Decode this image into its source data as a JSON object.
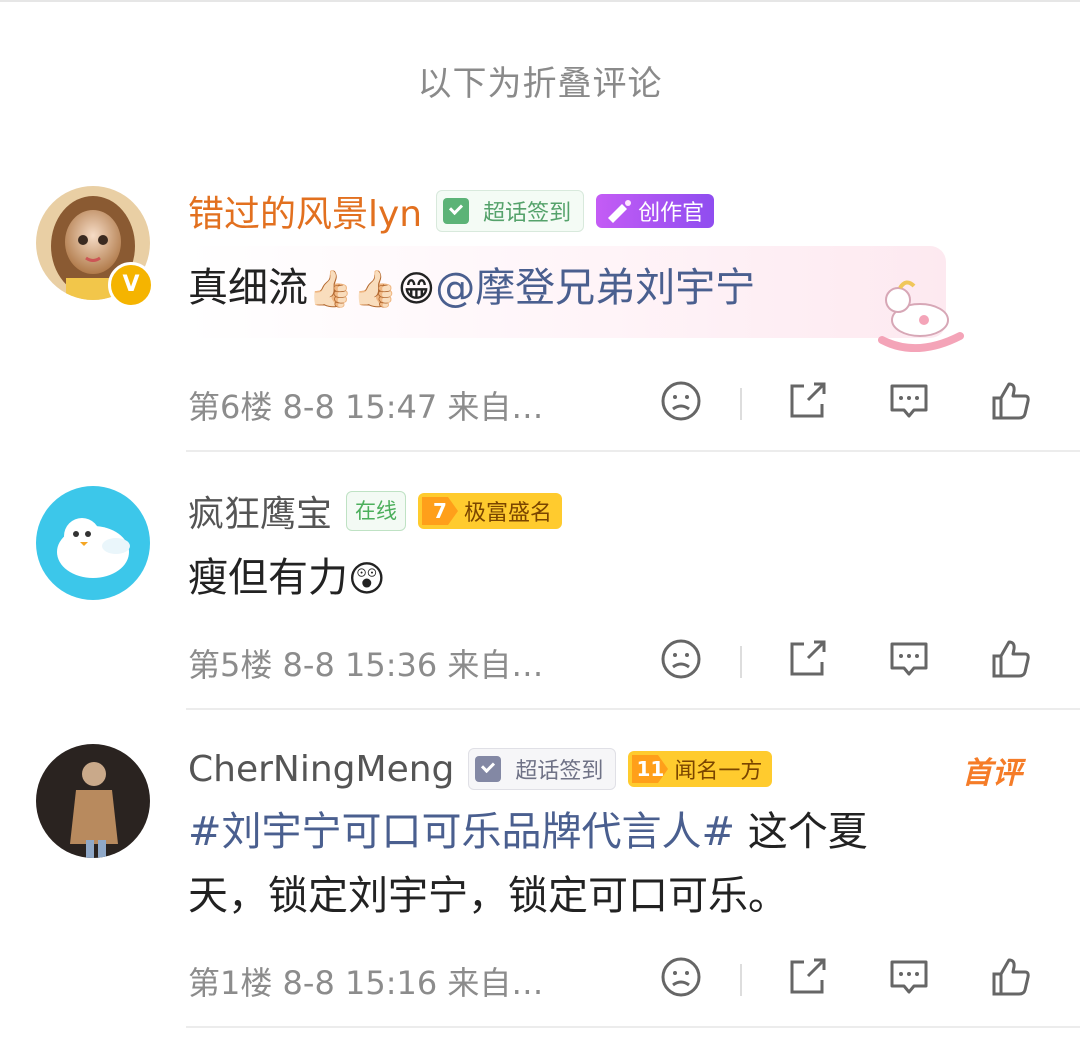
{
  "fold_header": "以下为折叠评论",
  "colors": {
    "accent_orange": "#e2701f",
    "mention_blue": "#4a5f8f",
    "meta_gray": "#8c8c8c"
  },
  "comments": [
    {
      "username": "错过的风景lyn",
      "badge_sign": "超话签到",
      "badge_creator": "创作官",
      "content_text": "真细流",
      "content_emoji": "👍🏻👍🏻😁",
      "mention": "@摩登兄弟刘宇宁",
      "floor": "第6楼",
      "date": "8-8",
      "time": "15:47",
      "source": "来自…",
      "verified_icon": "verified-v-icon"
    },
    {
      "username": "疯狂鹰宝",
      "badge_online": "在线",
      "level_num": "7",
      "level_label": "极富盛名",
      "content_text": "瘦但有力",
      "content_emoji": "😲",
      "floor": "第5楼",
      "date": "8-8",
      "time": "15:36",
      "source": "来自…"
    },
    {
      "username": "CherNingMeng",
      "badge_sign": "超话签到",
      "level_num": "11",
      "level_label": "闻名一方",
      "first_badge": "首评",
      "topic": "#刘宇宁可口可乐品牌代言人#",
      "content_line1": " 这个夏",
      "content_line2": "天，锁定刘宇宁，锁定可口可乐。",
      "floor": "第1楼",
      "date": "8-8",
      "time": "15:16",
      "source": "来自…"
    }
  ]
}
